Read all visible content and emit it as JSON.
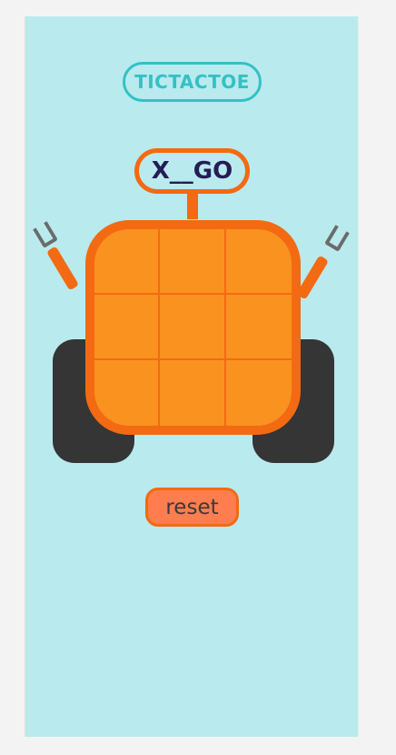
{
  "app": {
    "title": "TICTACTOE"
  },
  "status": {
    "text": "X__GO"
  },
  "board": {
    "cells": [
      "",
      "",
      "",
      "",
      "",
      "",
      "",
      "",
      ""
    ]
  },
  "controls": {
    "reset_label": "reset"
  },
  "colors": {
    "background": "#b9eaee",
    "accent": "#34c1c4",
    "robot_orange": "#f36a12",
    "board_fill": "#fa9220",
    "wheel": "#353535",
    "claw": "#6b6b6b",
    "reset_fill": "#ff7d4f",
    "status_text": "#251c55"
  },
  "icons": {
    "left_claw": "claw-icon",
    "right_claw": "claw-icon"
  }
}
